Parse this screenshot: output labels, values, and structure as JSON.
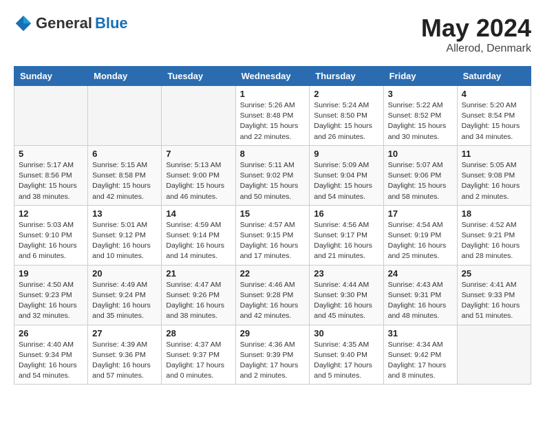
{
  "header": {
    "logo_general": "General",
    "logo_blue": "Blue",
    "month_title": "May 2024",
    "location": "Allerod, Denmark"
  },
  "calendar": {
    "days_of_week": [
      "Sunday",
      "Monday",
      "Tuesday",
      "Wednesday",
      "Thursday",
      "Friday",
      "Saturday"
    ],
    "weeks": [
      [
        {
          "day": "",
          "info": ""
        },
        {
          "day": "",
          "info": ""
        },
        {
          "day": "",
          "info": ""
        },
        {
          "day": "1",
          "info": "Sunrise: 5:26 AM\nSunset: 8:48 PM\nDaylight: 15 hours\nand 22 minutes."
        },
        {
          "day": "2",
          "info": "Sunrise: 5:24 AM\nSunset: 8:50 PM\nDaylight: 15 hours\nand 26 minutes."
        },
        {
          "day": "3",
          "info": "Sunrise: 5:22 AM\nSunset: 8:52 PM\nDaylight: 15 hours\nand 30 minutes."
        },
        {
          "day": "4",
          "info": "Sunrise: 5:20 AM\nSunset: 8:54 PM\nDaylight: 15 hours\nand 34 minutes."
        }
      ],
      [
        {
          "day": "5",
          "info": "Sunrise: 5:17 AM\nSunset: 8:56 PM\nDaylight: 15 hours\nand 38 minutes."
        },
        {
          "day": "6",
          "info": "Sunrise: 5:15 AM\nSunset: 8:58 PM\nDaylight: 15 hours\nand 42 minutes."
        },
        {
          "day": "7",
          "info": "Sunrise: 5:13 AM\nSunset: 9:00 PM\nDaylight: 15 hours\nand 46 minutes."
        },
        {
          "day": "8",
          "info": "Sunrise: 5:11 AM\nSunset: 9:02 PM\nDaylight: 15 hours\nand 50 minutes."
        },
        {
          "day": "9",
          "info": "Sunrise: 5:09 AM\nSunset: 9:04 PM\nDaylight: 15 hours\nand 54 minutes."
        },
        {
          "day": "10",
          "info": "Sunrise: 5:07 AM\nSunset: 9:06 PM\nDaylight: 15 hours\nand 58 minutes."
        },
        {
          "day": "11",
          "info": "Sunrise: 5:05 AM\nSunset: 9:08 PM\nDaylight: 16 hours\nand 2 minutes."
        }
      ],
      [
        {
          "day": "12",
          "info": "Sunrise: 5:03 AM\nSunset: 9:10 PM\nDaylight: 16 hours\nand 6 minutes."
        },
        {
          "day": "13",
          "info": "Sunrise: 5:01 AM\nSunset: 9:12 PM\nDaylight: 16 hours\nand 10 minutes."
        },
        {
          "day": "14",
          "info": "Sunrise: 4:59 AM\nSunset: 9:14 PM\nDaylight: 16 hours\nand 14 minutes."
        },
        {
          "day": "15",
          "info": "Sunrise: 4:57 AM\nSunset: 9:15 PM\nDaylight: 16 hours\nand 17 minutes."
        },
        {
          "day": "16",
          "info": "Sunrise: 4:56 AM\nSunset: 9:17 PM\nDaylight: 16 hours\nand 21 minutes."
        },
        {
          "day": "17",
          "info": "Sunrise: 4:54 AM\nSunset: 9:19 PM\nDaylight: 16 hours\nand 25 minutes."
        },
        {
          "day": "18",
          "info": "Sunrise: 4:52 AM\nSunset: 9:21 PM\nDaylight: 16 hours\nand 28 minutes."
        }
      ],
      [
        {
          "day": "19",
          "info": "Sunrise: 4:50 AM\nSunset: 9:23 PM\nDaylight: 16 hours\nand 32 minutes."
        },
        {
          "day": "20",
          "info": "Sunrise: 4:49 AM\nSunset: 9:24 PM\nDaylight: 16 hours\nand 35 minutes."
        },
        {
          "day": "21",
          "info": "Sunrise: 4:47 AM\nSunset: 9:26 PM\nDaylight: 16 hours\nand 38 minutes."
        },
        {
          "day": "22",
          "info": "Sunrise: 4:46 AM\nSunset: 9:28 PM\nDaylight: 16 hours\nand 42 minutes."
        },
        {
          "day": "23",
          "info": "Sunrise: 4:44 AM\nSunset: 9:30 PM\nDaylight: 16 hours\nand 45 minutes."
        },
        {
          "day": "24",
          "info": "Sunrise: 4:43 AM\nSunset: 9:31 PM\nDaylight: 16 hours\nand 48 minutes."
        },
        {
          "day": "25",
          "info": "Sunrise: 4:41 AM\nSunset: 9:33 PM\nDaylight: 16 hours\nand 51 minutes."
        }
      ],
      [
        {
          "day": "26",
          "info": "Sunrise: 4:40 AM\nSunset: 9:34 PM\nDaylight: 16 hours\nand 54 minutes."
        },
        {
          "day": "27",
          "info": "Sunrise: 4:39 AM\nSunset: 9:36 PM\nDaylight: 16 hours\nand 57 minutes."
        },
        {
          "day": "28",
          "info": "Sunrise: 4:37 AM\nSunset: 9:37 PM\nDaylight: 17 hours\nand 0 minutes."
        },
        {
          "day": "29",
          "info": "Sunrise: 4:36 AM\nSunset: 9:39 PM\nDaylight: 17 hours\nand 2 minutes."
        },
        {
          "day": "30",
          "info": "Sunrise: 4:35 AM\nSunset: 9:40 PM\nDaylight: 17 hours\nand 5 minutes."
        },
        {
          "day": "31",
          "info": "Sunrise: 4:34 AM\nSunset: 9:42 PM\nDaylight: 17 hours\nand 8 minutes."
        },
        {
          "day": "",
          "info": ""
        }
      ]
    ]
  }
}
